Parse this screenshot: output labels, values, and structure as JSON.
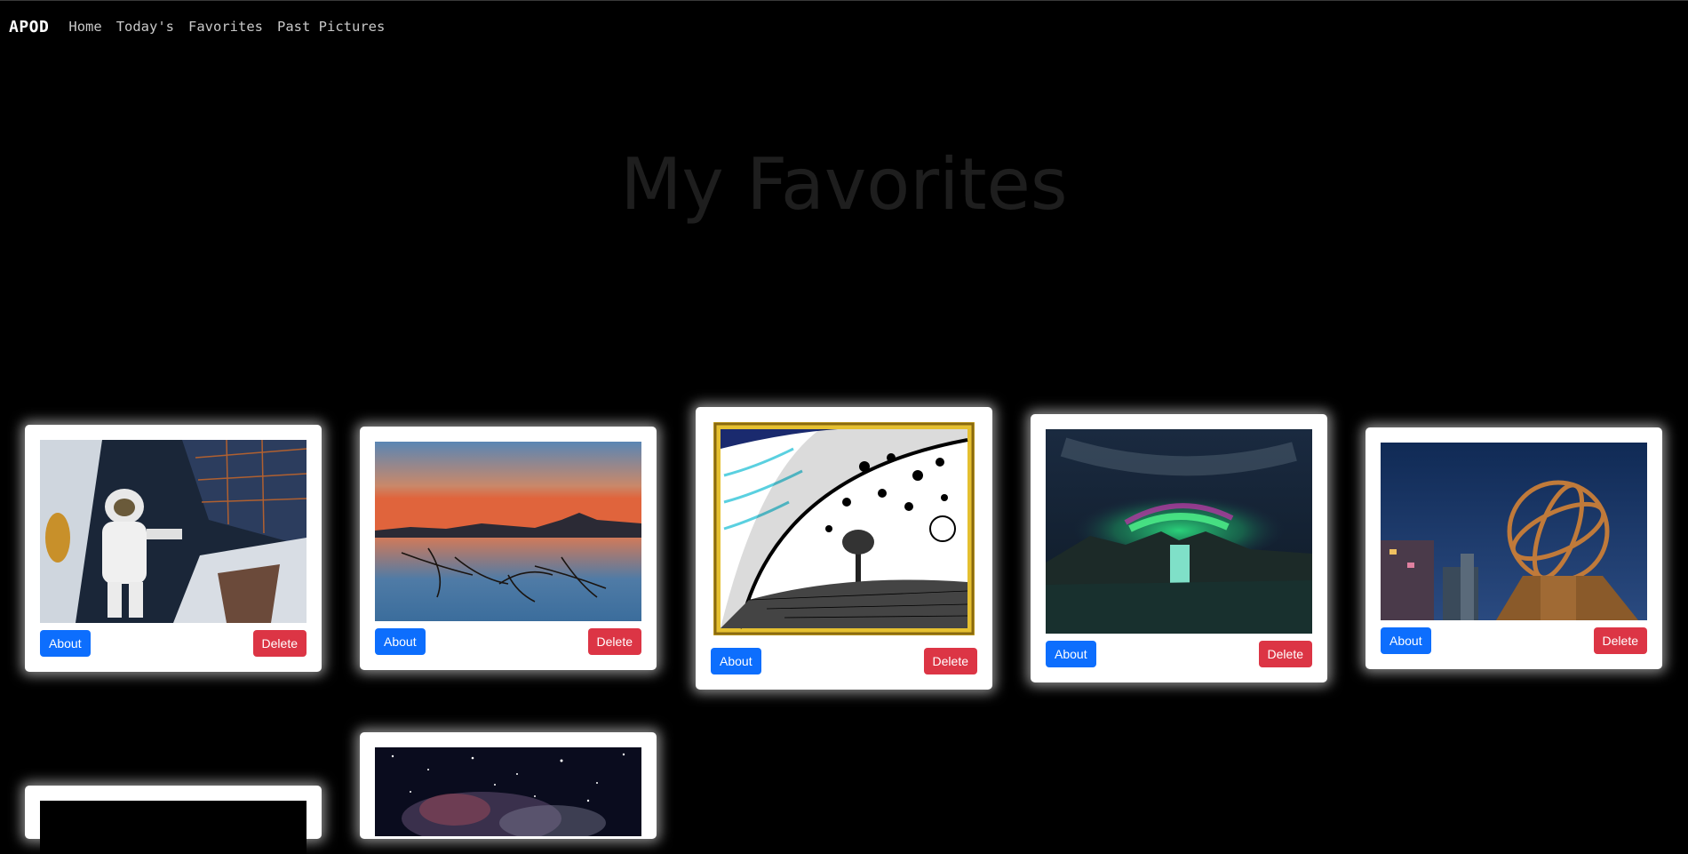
{
  "nav": {
    "brand": "APOD",
    "links": [
      "Home",
      "Today's",
      "Favorites",
      "Past Pictures"
    ]
  },
  "page_title": "My Favorites",
  "cards": [
    {
      "image": "astronaut-spacewalk",
      "about_label": "About",
      "delete_label": "Delete"
    },
    {
      "image": "sunset-lake-reflection",
      "about_label": "About",
      "delete_label": "Delete"
    },
    {
      "image": "flammarion-engraving",
      "about_label": "About",
      "delete_label": "Delete"
    },
    {
      "image": "aurora-waterfall",
      "about_label": "About",
      "delete_label": "Delete"
    },
    {
      "image": "armillary-sphere-night",
      "about_label": "About",
      "delete_label": "Delete"
    },
    {
      "image": "dark-image-partial"
    },
    {
      "image": "nebula-starfield-partial"
    }
  ],
  "colors": {
    "background": "#000000",
    "about_button": "#0d6efd",
    "delete_button": "#dc3545",
    "title": "#1e1e1e"
  }
}
